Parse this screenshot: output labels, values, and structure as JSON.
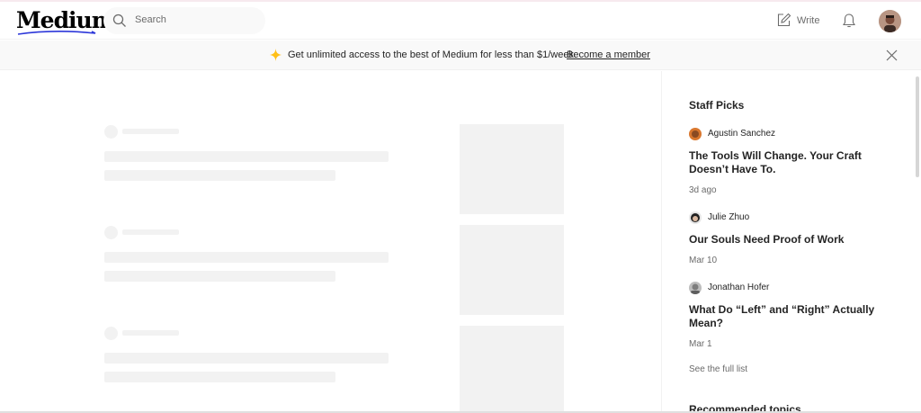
{
  "header": {
    "logo": "Medium",
    "search_placeholder": "Search",
    "write_label": "Write"
  },
  "banner": {
    "text": "Get unlimited access to the best of Medium for less than $1/week.",
    "link": "Become a member"
  },
  "sidebar": {
    "title": "Staff Picks",
    "picks": [
      {
        "author": "Agustin Sanchez",
        "title": "The Tools Will Change. Your Craft Doesn’t Have To.",
        "date": "3d ago"
      },
      {
        "author": "Julie Zhuo",
        "title": "Our Souls Need Proof of Work",
        "date": "Mar 10"
      },
      {
        "author": "Jonathan Hofer",
        "title": "What Do “Left” and “Right” Actually Mean?",
        "date": "Mar 1"
      }
    ],
    "full_list": "See the full list",
    "recommended_topics": "Recommended topics"
  },
  "colors": {
    "accent_underline": "#2c37d9",
    "sparkle": "#ffc017",
    "skeleton": "#f2f2f2",
    "banner_bg": "#f9f9f9"
  },
  "icons": [
    "search-icon",
    "write-icon",
    "bell-icon",
    "sparkle-icon",
    "close-icon"
  ]
}
